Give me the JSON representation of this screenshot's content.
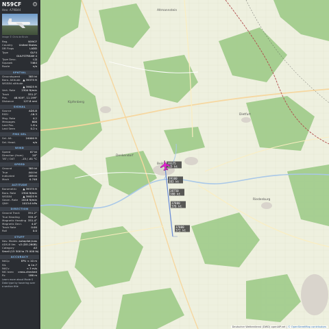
{
  "aircraft": {
    "callsign": "N59CF",
    "hex_label": "Hex:",
    "hex": "A79B44",
    "photo_credit": "Image © Chris de Bruin"
  },
  "info_rows": [
    {
      "k": "Reg.",
      "v": "N59CF"
    },
    {
      "k": "Country",
      "v": "United States"
    },
    {
      "k": "DB Flags",
      "v": "LADD"
    },
    {
      "k": "Type",
      "v": "GLF4"
    },
    {
      "k": "",
      "v": "GULFSTREAM 4"
    },
    {
      "k": "Type Desc.",
      "v": "L2J"
    },
    {
      "k": "Squawk",
      "v": "7464"
    },
    {
      "k": "Route",
      "v": "n/a"
    }
  ],
  "sections": [
    {
      "title": "SPATIAL",
      "rows": [
        {
          "k": "Groundspeed",
          "v": "385 kt"
        },
        {
          "k": "Baro. Altitude",
          "v": "▲ 39375 ft"
        },
        {
          "k": "WGS84 altitude",
          "v": ""
        },
        {
          "k": "",
          "v": "▲ 39825 ft"
        },
        {
          "k": "Vert. Rate",
          "v": "2304 ft/min"
        },
        {
          "k": "Track",
          "v": "351.2°"
        },
        {
          "k": "Pos.",
          "v": "48.919°, 11.199°"
        },
        {
          "k": "Distance",
          "v": "127.8 nmi"
        }
      ]
    },
    {
      "title": "SIGNAL",
      "rows": [
        {
          "k": "Source",
          "v": "ADS-B"
        },
        {
          "k": "RSSI",
          "v": "-16.3"
        },
        {
          "k": "Msg. Rate",
          "v": "4.2"
        },
        {
          "k": "Messages",
          "v": "606"
        },
        {
          "k": "Last Pos.",
          "v": "1.8 s"
        },
        {
          "k": "Last Seen",
          "v": "0.2 s"
        }
      ]
    },
    {
      "title": "FMS SEL",
      "rows": [
        {
          "k": "Sel. Alt.",
          "v": "24000 ft"
        },
        {
          "k": "Sel. Head.",
          "v": "n/a"
        }
      ]
    },
    {
      "title": "WIND",
      "rows": [
        {
          "k": "Speed",
          "v": "67 kt"
        },
        {
          "k": "Direction (from)",
          "v": "20°"
        },
        {
          "k": "TAT / OAT",
          "v": "-15 / -61 °C"
        }
      ]
    },
    {
      "title": "SPEED",
      "rows": [
        {
          "k": "Ground",
          "v": "385 kt"
        },
        {
          "k": "True",
          "v": "444 kt"
        },
        {
          "k": "Indicated",
          "v": "289 kt"
        },
        {
          "k": "Mach",
          "v": "0.748"
        }
      ]
    },
    {
      "title": "ALTITUDE",
      "rows": [
        {
          "k": "Barometric",
          "v": "▲ 39375 ft"
        },
        {
          "k": "Baro. Rate",
          "v": "2304 ft/min"
        },
        {
          "k": "WGS84",
          "v": "▲ 39825 ft"
        },
        {
          "k": "Geom. Rate",
          "v": "2016 ft/min"
        },
        {
          "k": "QNH",
          "v": "1013.6 hPa"
        }
      ]
    },
    {
      "title": "DIRECTION",
      "rows": [
        {
          "k": "Ground Track",
          "v": "351.2°"
        },
        {
          "k": "True Heading",
          "v": "355.4°"
        },
        {
          "k": "Magnetic Heading",
          "v": "351.4°"
        },
        {
          "k": "Magnetic Decl.",
          "v": "4.0°"
        },
        {
          "k": "Track Rate",
          "v": "0.00"
        },
        {
          "k": "Roll",
          "v": "0.0"
        }
      ]
    },
    {
      "title": "STUFF",
      "rows": [
        {
          "k": "Nav. Modes",
          "v": "autopilot,tcas"
        },
        {
          "k": "ADS-B Ver.",
          "v": "v2 (DO-260B)"
        },
        {
          "k": "Category",
          "v": "A3"
        },
        {
          "k": "",
          "v": "Small (15 500 to 75 000 lb)"
        }
      ]
    },
    {
      "title": "ACCURACY",
      "rows": [
        {
          "k": "NACp",
          "v": "EPU < 10 m"
        },
        {
          "k": "SIL",
          "v": "≤ 1e-7"
        },
        {
          "k": "NACv",
          "v": "< 3 m/s"
        },
        {
          "k": "NIC baro",
          "v": "cross-checked"
        },
        {
          "k": "Rc",
          "v": "186 m"
        }
      ]
    }
  ],
  "footnote": "Learn more about Mode S Data type by hovering over a section title",
  "map": {
    "attribution": "Deutscher Wetterdienst (DWD) openAIP.net",
    "attribution_link": "© OpenStreetMap contributors",
    "towns": [
      "Altmannstein",
      "Kipfenberg",
      "Beilngries",
      "Denkendorf",
      "Dietfurt",
      "Riedenburg"
    ],
    "data_labels": [
      {
        "line1": "39375",
        "line2": "385 kt"
      },
      {
        "line1": "39100",
        "line2": "383 kt"
      },
      {
        "line1": "38750",
        "line2": "380 kt"
      },
      {
        "line1": "37800",
        "line2": "376 kt"
      },
      {
        "line1": "37000",
        "line2": "372 kt"
      }
    ]
  },
  "colors": {
    "track": "#6d8ed6",
    "aircraft": "#e51fd2",
    "forest": "#8bbf78",
    "field": "#eef0df"
  }
}
